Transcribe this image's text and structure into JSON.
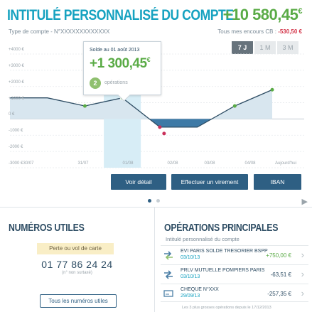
{
  "account": {
    "title": "INTITULÉ PERSONNALISÉ DU COMPTE",
    "subtitle": "Type de compte - N°XXXXXXXXXXXXX",
    "balance_main": "+10 580,45",
    "balance_currency": "€",
    "encours_label": "Tous mes encours CB :",
    "encours_value": "-530,50 €"
  },
  "periods": [
    {
      "label": "7 J",
      "active": true
    },
    {
      "label": "1 M",
      "active": false
    },
    {
      "label": "3 M",
      "active": false
    }
  ],
  "tooltip": {
    "label": "Solde au 01 août 2013",
    "amount": "+1 300,45",
    "currency": "€",
    "ops_count": "2",
    "ops_label": "opérations"
  },
  "chart_data": {
    "type": "area",
    "y_ticks": [
      "+4000 €",
      "+3000 €",
      "+2000 €",
      "+1000 €",
      "0 €",
      "-1000 €",
      "-2000 €",
      "-3000 €"
    ],
    "x": [
      "30/07",
      "31/07",
      "01/08",
      "02/08",
      "03/08",
      "04/08",
      "Aujourd'hui"
    ],
    "values": [
      1300,
      1300,
      800,
      1300,
      -500,
      -500,
      800,
      1800
    ],
    "point_labels": [
      "",
      "",
      "",
      "01/08",
      "02/08",
      "",
      "",
      "Aujourd'hui"
    ],
    "ylim": [
      -3000,
      4000
    ],
    "highlighted": "01/08",
    "colors": {
      "positive_fill": "#d8e6ef",
      "negative_fill": "#3e7aa6",
      "line": "#2d4c63",
      "highlight_band": "#d7edf6"
    }
  },
  "actions": {
    "detail": "Voir détail",
    "transfer": "Effectuer un virement",
    "iban": "IBAN"
  },
  "pager": {
    "count": 2,
    "active": 0
  },
  "numbers": {
    "title": "NUMÉROS UTILES",
    "lost_card": "Perte ou vol de carte",
    "phone": "01 77 86 24 24",
    "phone_note": "(n° non surtaxé)",
    "all_button": "Tous les numéros utiles"
  },
  "operations": {
    "title": "OPÉRATIONS PRINCIPALES",
    "subtitle": "Intitulé personnalisé du compte",
    "items": [
      {
        "label": "EVI PARIS SOLDE TRESORIER BSPP",
        "date": "03/10/13",
        "amount": "+750,00 €",
        "positive": true,
        "icon": "transfer-in-icon"
      },
      {
        "label": "PRLV MUTUELLE POMPIERS PARIS",
        "date": "03/10/13",
        "amount": "-63,51 €",
        "positive": false,
        "icon": "transfer-out-icon"
      },
      {
        "label": "CHEQUE N°XXX",
        "date": "29/09/13",
        "amount": "-257,35 €",
        "positive": false,
        "icon": "cheque-icon"
      }
    ],
    "footer": "Les 3 plus grosses opérations depuis le 17/12/2013"
  }
}
